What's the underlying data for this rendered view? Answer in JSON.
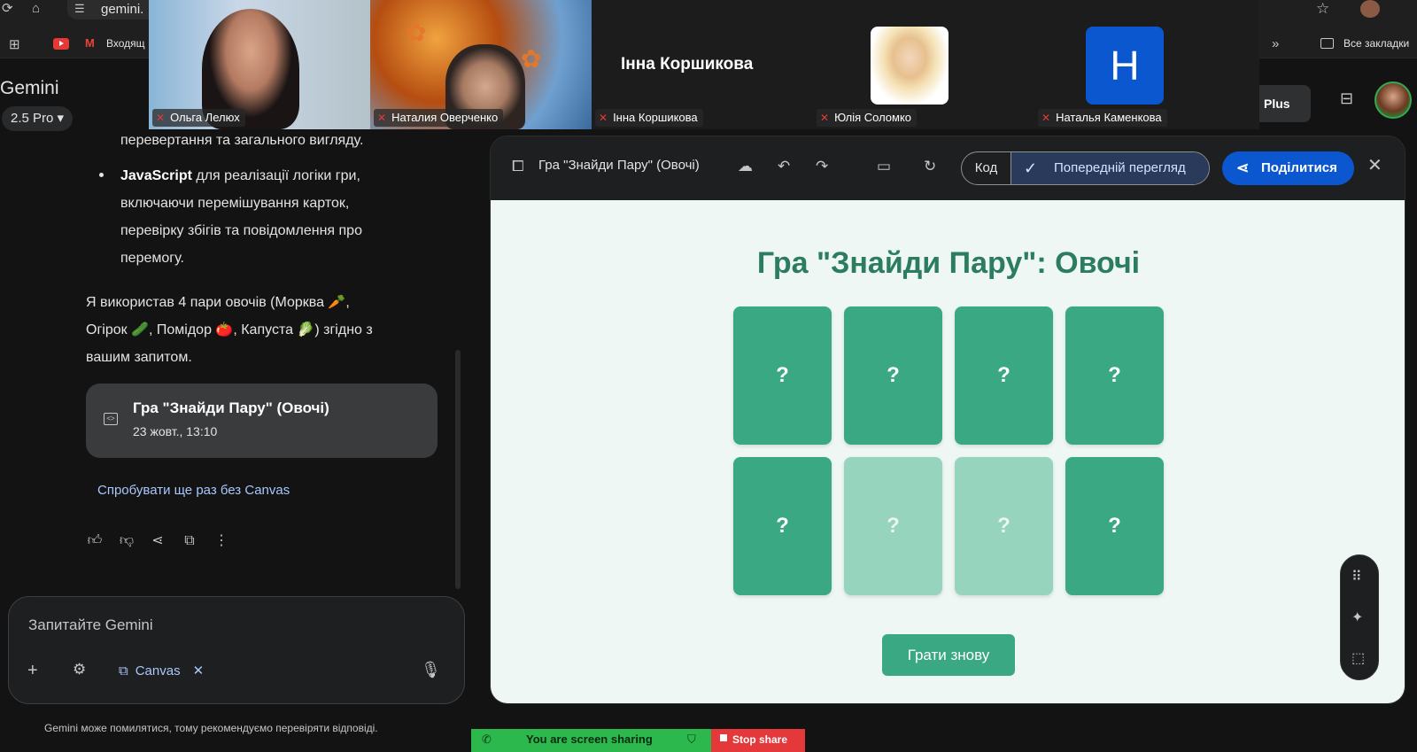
{
  "browser": {
    "url_text": "gemini.",
    "bookmark_inbox": "Входящ",
    "all_bookmarks": "Все закладки"
  },
  "video_call": {
    "participants": [
      {
        "name": "Ольга Лелюх"
      },
      {
        "name": "Наталия Оверченко"
      },
      {
        "name": "Інна Коршикова"
      },
      {
        "name": "Юлія Соломко"
      },
      {
        "name": "Наталья Каменкова"
      }
    ],
    "featured_name": "Інна Коршикова",
    "avatar_letter": "Н"
  },
  "gemini": {
    "title": "Gemini",
    "model": "2.5 Pro",
    "plus_label": "Plus",
    "chat": {
      "line_partial": "перевертання та загального вигляду.",
      "bullet_bold": "JavaScript",
      "bullet_rest_1": " для реалізації логіки гри,",
      "bullet_line_2": "включаючи перемішування карток,",
      "bullet_line_3": "перевірку збігів та повідомлення про",
      "bullet_line_4": "перемогу.",
      "para_line_1": "Я використав 4 пари овочів (Морква 🥕,",
      "para_line_2": "Огірок 🥒, Помідор 🍅, Капуста 🥬) згідно з",
      "para_line_3": "вашим запитом."
    },
    "artifact": {
      "title": "Гра \"Знайди Пару\" (Овочі)",
      "date": "23 жовт., 13:10"
    },
    "retry_link": "Спробувати ще раз без Canvas",
    "input_placeholder": "Запитайте Gemini",
    "canvas_chip": "Canvas",
    "disclaimer": "Gemini може помилятися, тому рекомендуємо перевіряти відповіді."
  },
  "canvas": {
    "title": "Гра \"Знайди Пару\" (Овочі)",
    "code_tab": "Код",
    "preview_tab": "Попередній перегляд",
    "share_label": "Поділитися",
    "game": {
      "heading": "Гра \"Знайди Пару\": Овочі",
      "cards": [
        {
          "face": "?",
          "state": "hidden"
        },
        {
          "face": "?",
          "state": "hidden"
        },
        {
          "face": "?",
          "state": "hidden"
        },
        {
          "face": "?",
          "state": "hidden"
        },
        {
          "face": "?",
          "state": "hidden"
        },
        {
          "face": "?",
          "state": "flipping"
        },
        {
          "face": "?",
          "state": "flipping"
        },
        {
          "face": "?",
          "state": "hidden"
        }
      ],
      "replay_label": "Грати знову"
    }
  },
  "screen_share": {
    "status": "You are screen sharing",
    "stop_label": "Stop share"
  },
  "colors": {
    "card_green": "#3aa983",
    "card_flipping": "#97d4bd",
    "title_green": "#2c7c5f",
    "accent_blue": "#0b57d0"
  }
}
